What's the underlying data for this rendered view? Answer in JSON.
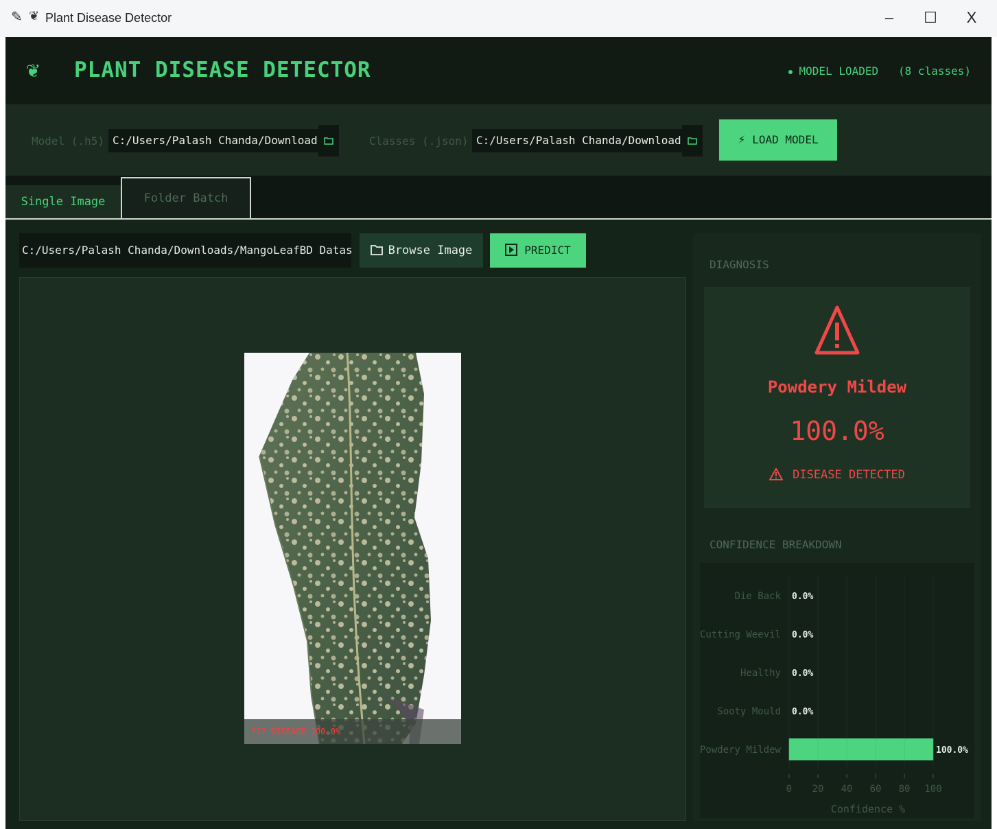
{
  "window": {
    "title": "Plant Disease Detector",
    "controls": {
      "minimize": "–",
      "maximize": "☐",
      "close": "X"
    }
  },
  "header": {
    "title": "PLANT DISEASE DETECTOR",
    "status": "MODEL LOADED",
    "class_count": "(8 classes)"
  },
  "model_bar": {
    "model_label": "Model (.h5)",
    "model_path": "C:/Users/Palash Chanda/Downloads,",
    "classes_label": "Classes (.json)",
    "classes_path": "C:/Users/Palash Chanda/Downloads,",
    "load_button": "LOAD MODEL"
  },
  "tabs": [
    {
      "label": "Single Image",
      "active": true
    },
    {
      "label": "Folder Batch",
      "active": false
    }
  ],
  "single_image": {
    "image_path": "C:/Users/Palash Chanda/Downloads/MangoLeafBD Dataset,",
    "browse_button": "Browse Image",
    "predict_button": "PREDICT",
    "image_overlay": "??? DISEASE 100.0%"
  },
  "diagnosis": {
    "section_title": "DIAGNOSIS",
    "class_name": "Powdery Mildew",
    "confidence": "100.0%",
    "status": "DISEASE DETECTED"
  },
  "breakdown": {
    "section_title": "CONFIDENCE BREAKDOWN"
  },
  "colors": {
    "accent": "#4dd47f",
    "danger": "#f04848",
    "background": "#101a13",
    "panel": "#1c2e21"
  },
  "chart_data": {
    "type": "bar",
    "orientation": "horizontal",
    "categories": [
      "Die Back",
      "Cutting Weevil",
      "Healthy",
      "Sooty Mould",
      "Powdery Mildew"
    ],
    "values": [
      0.0,
      0.0,
      0.0,
      0.0,
      100.0
    ],
    "value_labels": [
      "0.0%",
      "0.0%",
      "0.0%",
      "0.0%",
      "100.0%"
    ],
    "xlabel": "Confidence %",
    "xlim": [
      0,
      100
    ],
    "xticks": [
      "0",
      "20",
      "40",
      "60",
      "80",
      "100"
    ],
    "grid": true
  }
}
